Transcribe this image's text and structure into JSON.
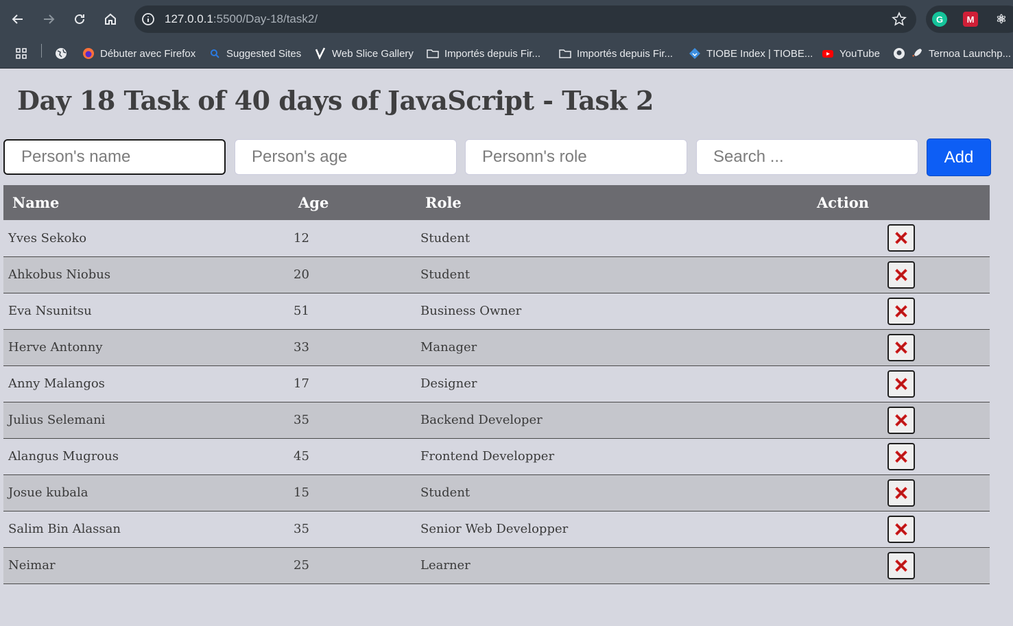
{
  "browser": {
    "url_host": "127.0.0.1",
    "url_path": ":5500/Day-18/task2/",
    "bookmarks": [
      {
        "label": "Débuter avec Firefox",
        "icon": "firefox-icon",
        "color": "#ff7139"
      },
      {
        "label": "Suggested Sites",
        "icon": "suggested-sites-icon",
        "color": "#2a7ae2"
      },
      {
        "label": "Web Slice Gallery",
        "icon": "web-slice-icon",
        "color": "#ffffff"
      },
      {
        "label": "Importés depuis Fir...",
        "icon": "folder-icon",
        "color": "#e8eaed"
      },
      {
        "label": "Importés depuis Fir...",
        "icon": "folder-icon",
        "color": "#e8eaed"
      },
      {
        "label": "TIOBE Index | TIOBE...",
        "icon": "tiobe-icon",
        "color": "#3d8fe0"
      },
      {
        "label": "YouTube",
        "icon": "youtube-icon",
        "color": "#ff0000"
      },
      {
        "label": "Ternoa Launchp...",
        "icon": "rocket-icon",
        "color": "#e8eaed"
      }
    ],
    "extensions": [
      {
        "icon": "grammarly-icon",
        "color": "#15c39a",
        "glyph": "G"
      },
      {
        "icon": "mendeley-icon",
        "color": "#d01f37",
        "glyph": "M"
      },
      {
        "icon": "react-devtools-icon",
        "color": "#61dafb",
        "glyph": "⚛"
      }
    ]
  },
  "page": {
    "title": "Day 18 Task of 40 days of JavaScript - Task 2",
    "inputs": {
      "name_placeholder": "Person's name",
      "age_placeholder": "Person's age",
      "role_placeholder": "Personn's role",
      "search_placeholder": "Search ..."
    },
    "add_label": "Add",
    "table": {
      "headers": {
        "name": "Name",
        "age": "Age",
        "role": "Role",
        "action": "Action"
      },
      "rows": [
        {
          "name": "Yves Sekoko",
          "age": "12",
          "role": "Student"
        },
        {
          "name": "Ahkobus Niobus",
          "age": "20",
          "role": "Student"
        },
        {
          "name": "Eva Nsunitsu",
          "age": "51",
          "role": "Business Owner"
        },
        {
          "name": "Herve Antonny",
          "age": "33",
          "role": "Manager"
        },
        {
          "name": "Anny Malangos",
          "age": "17",
          "role": "Designer"
        },
        {
          "name": "Julius Selemani",
          "age": "35",
          "role": "Backend Developer"
        },
        {
          "name": "Alangus Mugrous",
          "age": "45",
          "role": "Frontend Developper"
        },
        {
          "name": "Josue kubala",
          "age": "15",
          "role": "Student"
        },
        {
          "name": "Salim Bin Alassan",
          "age": "35",
          "role": "Senior Web Developper"
        },
        {
          "name": "Neimar",
          "age": "25",
          "role": "Learner"
        }
      ]
    }
  },
  "colors": {
    "page_bg": "#d6d7e0",
    "header_bg": "#6b6b70",
    "add_button": "#0d5ef5",
    "delete_x": "#d01b1b"
  }
}
